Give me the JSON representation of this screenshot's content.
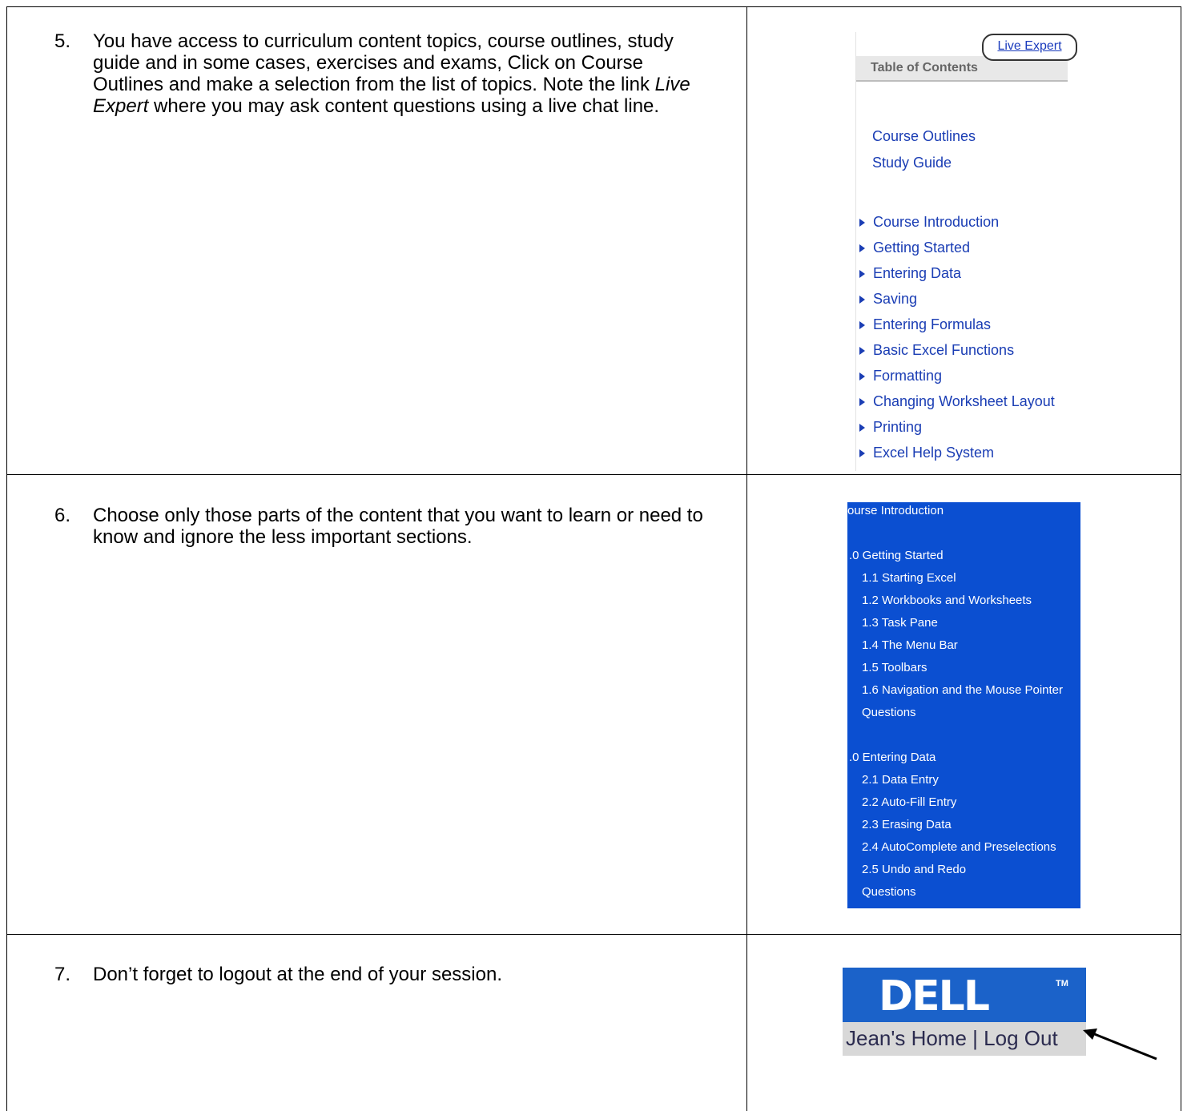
{
  "steps": [
    {
      "number": "5.",
      "text_before": "You have access to curriculum content topics, course outlines, study guide and in some cases, exercises and exams, Click on Course Outlines and make a selection from the list of topics. Note the link ",
      "text_em": "Live Expert",
      "text_after": " where you may ask content questions using a live chat line."
    },
    {
      "number": "6.",
      "text": "Choose only those parts of the content that you want to learn or need to know and ignore the less important sections."
    },
    {
      "number": "7.",
      "text": "Don’t forget to logout at the end of your session."
    }
  ],
  "toc": {
    "live_expert": "Live Expert",
    "header": "Table of Contents",
    "links": [
      "Course Outlines",
      "Study Guide"
    ],
    "topics": [
      "Course Introduction",
      "Getting Started",
      "Entering Data",
      "Saving",
      "Entering Formulas",
      "Basic Excel Functions",
      "Formatting",
      "Changing Worksheet Layout",
      "Printing",
      "Excel Help System"
    ]
  },
  "outline": {
    "lines": [
      "ourse Introduction",
      ".0 Getting Started",
      "1.1 Starting Excel",
      "1.2 Workbooks and Worksheets",
      "1.3 Task Pane",
      "1.4 The Menu Bar",
      "1.5 Toolbars",
      "1.6 Navigation and the Mouse Pointer",
      "Questions",
      ".0 Entering Data",
      "2.1 Data Entry",
      "2.2 Auto-Fill Entry",
      "2.3 Erasing Data",
      "2.4 AutoComplete and Preselections",
      "2.5 Undo and Redo",
      "Questions"
    ]
  },
  "dell": {
    "logo": "DELL",
    "tm": "TM",
    "home": "Jean's Home",
    "separator": "|",
    "logout": "Log Out"
  },
  "colors": {
    "link_blue": "#1a3db4",
    "outline_bg": "#0b4fd1",
    "dell_blue": "#1b62c9"
  }
}
